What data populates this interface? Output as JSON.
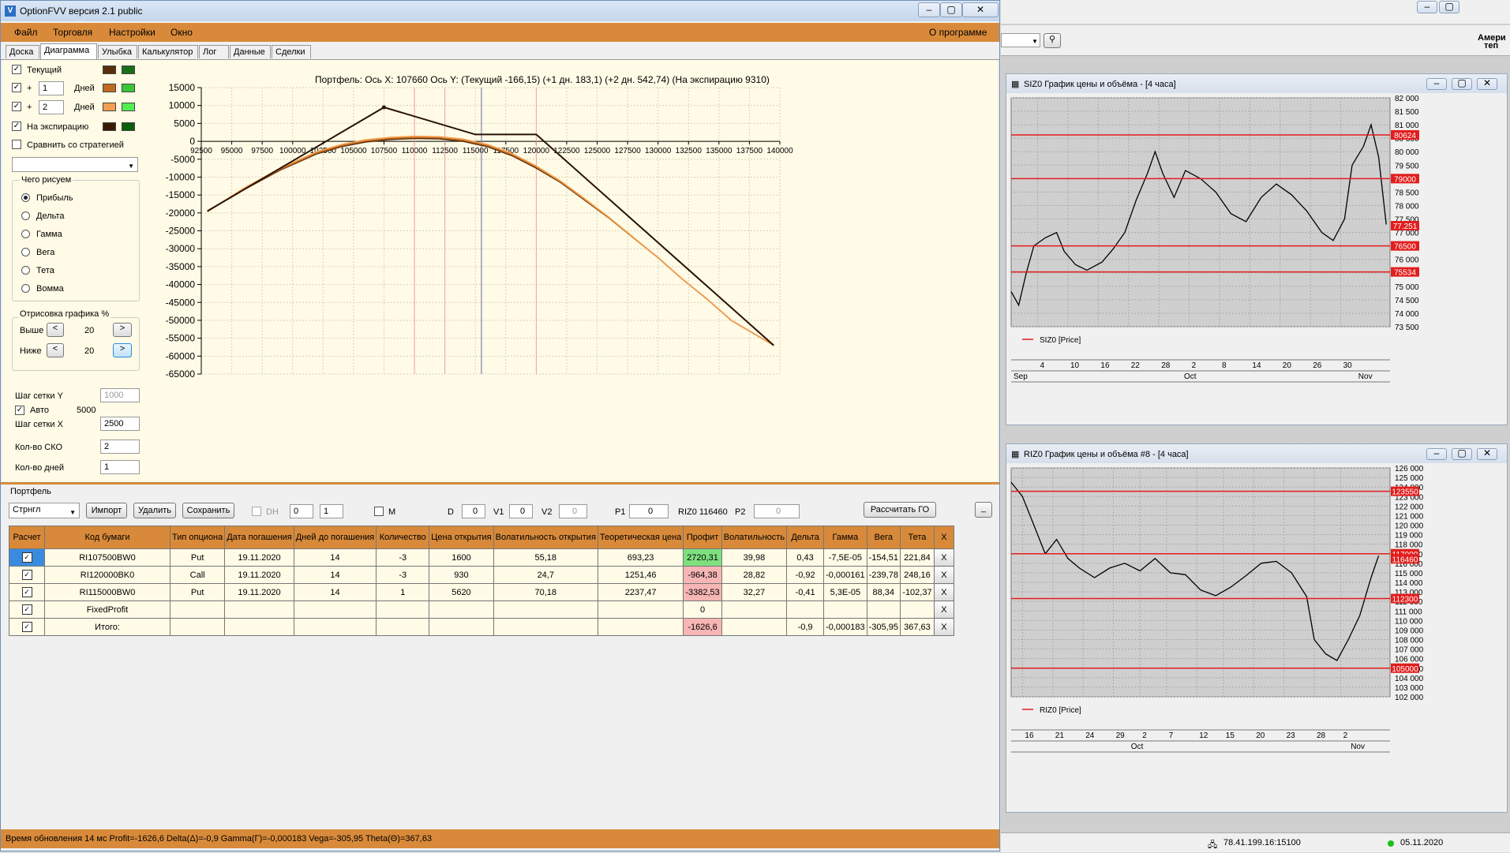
{
  "window": {
    "title": "OptionFVV версия 2.1 public",
    "about": "О программе",
    "menu": [
      "Файл",
      "Торговля",
      "Настройки",
      "Окно"
    ],
    "tabs": [
      "Доска",
      "Диаграмма",
      "Улыбка",
      "Калькулятор",
      "Лог",
      "Данные",
      "Сделки"
    ],
    "active_tab": "Диаграмма"
  },
  "left_panel": {
    "current_label": "Текущий",
    "plus": "+",
    "days_label": "Дней",
    "days1": "1",
    "days2": "2",
    "expiry_label": "На экспирацию",
    "compare_label": "Сравнить со стратегией",
    "what_label": "Чего рисуем",
    "radios": [
      "Прибыль",
      "Дельта",
      "Гамма",
      "Вега",
      "Тета",
      "Вомма"
    ],
    "draw_label": "Отрисовка графика %",
    "above_label": "Выше",
    "below_label": "Ниже",
    "above_value": "20",
    "below_value": "20",
    "step_y_label": "Шаг сетки Y",
    "step_y_value": "1000",
    "auto_label": "Авто",
    "auto_value": "5000",
    "step_x_label": "Шаг сетки X",
    "step_x_value": "2500",
    "sko_label": "Кол-во СКО",
    "sko_value": "2",
    "days_count_label": "Кол-во дней",
    "days_count_value": "1",
    "colors": {
      "current": [
        "#5a2e0a",
        "#1a6e1a"
      ],
      "day1": [
        "#c06a20",
        "#3ac43a"
      ],
      "day2": [
        "#f5a050",
        "#50ee50"
      ],
      "expiry": [
        "#3a1a05",
        "#0b5e0b"
      ]
    }
  },
  "chart_header": "Портфель: Ось X:  107660 Ось Y:   (Текущий -166,15)  (+1 дн. 183,1)  (+2 дн. 542,74)  (На экспирацию 9310)",
  "chart_data": {
    "type": "line",
    "xlim": [
      92500,
      140000
    ],
    "ylim": [
      -65000,
      15000
    ],
    "x_ticks": [
      "92500",
      "95000",
      "97500",
      "100000",
      "102500",
      "105000",
      "107500",
      "110000",
      "112500",
      "115000",
      "117500",
      "120000",
      "122500",
      "125000",
      "127500",
      "130000",
      "132500",
      "135000",
      "137500",
      "140000"
    ],
    "y_ticks": [
      "15000",
      "10000",
      "5000",
      "0",
      "-5000",
      "-10000",
      "-15000",
      "-20000",
      "-25000",
      "-30000",
      "-35000",
      "-40000",
      "-45000",
      "-50000",
      "-55000",
      "-60000",
      "-65000"
    ],
    "cursor_x": 107660,
    "std_lines_x": [
      110000,
      112500,
      120000
    ],
    "current_x": 115500,
    "series": [
      {
        "name": "Текущий",
        "color": "#5a2e0a",
        "points": [
          [
            93000,
            -19500
          ],
          [
            96000,
            -13500
          ],
          [
            99000,
            -8000
          ],
          [
            102000,
            -3500
          ],
          [
            104000,
            -1500
          ],
          [
            106000,
            -200
          ],
          [
            108000,
            500
          ],
          [
            110000,
            800
          ],
          [
            112000,
            700
          ],
          [
            114000,
            0
          ],
          [
            116000,
            -1500
          ],
          [
            118000,
            -4000
          ],
          [
            120000,
            -7500
          ],
          [
            122000,
            -11500
          ],
          [
            124000,
            -16500
          ],
          [
            126000,
            -21500
          ],
          [
            128000,
            -27000
          ],
          [
            130000,
            -32500
          ],
          [
            132000,
            -38500
          ],
          [
            134000,
            -44000
          ],
          [
            136000,
            -50000
          ],
          [
            139500,
            -57000
          ]
        ]
      },
      {
        "name": "+1 дн.",
        "color": "#c06a20",
        "points": [
          [
            93000,
            -19600
          ],
          [
            96000,
            -13300
          ],
          [
            99000,
            -7800
          ],
          [
            102000,
            -3200
          ],
          [
            104000,
            -1200
          ],
          [
            106000,
            100
          ],
          [
            108000,
            800
          ],
          [
            110000,
            1100
          ],
          [
            112000,
            1000
          ],
          [
            114000,
            300
          ],
          [
            116000,
            -1200
          ],
          [
            118000,
            -3700
          ],
          [
            120000,
            -7200
          ],
          [
            122000,
            -11300
          ],
          [
            124000,
            -16300
          ],
          [
            126000,
            -21400
          ],
          [
            128000,
            -27000
          ],
          [
            130000,
            -32500
          ],
          [
            132000,
            -38500
          ],
          [
            134000,
            -44000
          ],
          [
            136000,
            -50000
          ],
          [
            139500,
            -57000
          ]
        ]
      },
      {
        "name": "+2 дн.",
        "color": "#f5a050",
        "points": [
          [
            93000,
            -19700
          ],
          [
            96000,
            -13100
          ],
          [
            99000,
            -7500
          ],
          [
            102000,
            -2900
          ],
          [
            104000,
            -900
          ],
          [
            106000,
            400
          ],
          [
            108000,
            1100
          ],
          [
            110000,
            1400
          ],
          [
            112000,
            1300
          ],
          [
            114000,
            600
          ],
          [
            116000,
            -900
          ],
          [
            118000,
            -3400
          ],
          [
            120000,
            -6900
          ],
          [
            122000,
            -11100
          ],
          [
            124000,
            -16100
          ],
          [
            126000,
            -21300
          ],
          [
            128000,
            -26900
          ],
          [
            130000,
            -32500
          ],
          [
            132000,
            -38500
          ],
          [
            134000,
            -44000
          ],
          [
            136000,
            -50000
          ],
          [
            139500,
            -57000
          ]
        ]
      },
      {
        "name": "На экспирацию",
        "color": "#2a1205",
        "points": [
          [
            93000,
            -19500
          ],
          [
            107500,
            9500
          ],
          [
            115000,
            1900
          ],
          [
            120000,
            1900
          ],
          [
            139500,
            -57000
          ]
        ]
      }
    ]
  },
  "portfolio": {
    "label": "Портфель",
    "combo": "Стрнгл",
    "import": "Импорт",
    "delete": "Удалить",
    "save": "Сохранить",
    "dh": "DH",
    "dh_val1": "0",
    "dh_val2": "1",
    "m": "M",
    "d_label": "D",
    "d_val": "0",
    "v1_label": "V1",
    "v1_val": "0",
    "v2_label": "V2",
    "v2_val": "0",
    "p1_label": "P1",
    "p1_val": "0",
    "riz_label": "RIZ0 116460",
    "p2_label": "P2",
    "p2_val": "0",
    "calc_go": "Рассчитать ГО",
    "minimize": "_",
    "headers": [
      "Расчет",
      "Код бумаги",
      "Тип опциона",
      "Дата погашения",
      "Дней до погашения",
      "Количество",
      "Цена открытия",
      "Волатильность открытия",
      "Теоретическая цена",
      "Профит",
      "Волатильность",
      "Дельта",
      "Гамма",
      "Вега",
      "Тета",
      "X"
    ],
    "rows": [
      [
        "RI107500BW0",
        "Put",
        "19.11.2020",
        "14",
        "-3",
        "1600",
        "55,18",
        "693,23",
        "2720,31",
        "39,98",
        "0,43",
        "-7,5E-05",
        "-154,51",
        "221,84",
        "X"
      ],
      [
        "RI120000BK0",
        "Call",
        "19.11.2020",
        "14",
        "-3",
        "930",
        "24,7",
        "1251,46",
        "-964,38",
        "28,82",
        "-0,92",
        "-0,000161",
        "-239,78",
        "248,16",
        "X"
      ],
      [
        "RI115000BW0",
        "Put",
        "19.11.2020",
        "14",
        "1",
        "5620",
        "70,18",
        "2237,47",
        "-3382,53",
        "32,27",
        "-0,41",
        "5,3E-05",
        "88,34",
        "-102,37",
        "X"
      ],
      [
        "FixedProfit",
        "",
        "",
        "",
        "",
        "",
        "",
        "",
        "0",
        "",
        "",
        "",
        "",
        "",
        "X"
      ],
      [
        "Итого:",
        "",
        "",
        "",
        "",
        "",
        "",
        "",
        "-1626,6",
        "",
        "-0,9",
        "-0,000183",
        "-305,95",
        "367,63",
        "X"
      ]
    ]
  },
  "status": "Время обновления 14 мс  Profit=-1626,6 Delta(Δ)=-0,9 Gamma(Γ)=-0,000183 Vega=-305,95 Theta(Θ)=367,63",
  "right": {
    "top_label": "Амери",
    "top_label2": "теп",
    "chart1": {
      "title": "SIZ0 График цены и объёма - [4 часа]",
      "legend": "SIZ0 [Price]",
      "y_labels": [
        "82 000",
        "81 500",
        "81 000",
        "80 500",
        "80 000",
        "79 500",
        "79 000",
        "78 500",
        "78 000",
        "77 500",
        "77 000",
        "76 500",
        "76 000",
        "75 500",
        "75 000",
        "74 500",
        "74 000",
        "73 500"
      ],
      "x_labels": [
        "4",
        "10",
        "16",
        "22",
        "28",
        "2",
        "8",
        "14",
        "20",
        "26",
        "30"
      ],
      "months": [
        "Sep",
        "Oct",
        "Nov"
      ],
      "tags": [
        "80624",
        "79000",
        "77.251",
        "76500",
        "75534"
      ]
    },
    "chart2": {
      "title": "RIZ0 График цены и объёма #8 - [4 часа]",
      "legend": "RIZ0 [Price]",
      "y_labels": [
        "126 000",
        "125 000",
        "124 000",
        "123 000",
        "122 000",
        "121 000",
        "120 000",
        "119 000",
        "118 000",
        "117 000",
        "116 000",
        "115 000",
        "114 000",
        "113 000",
        "112 000",
        "111 000",
        "110 000",
        "109 000",
        "108 000",
        "107 000",
        "106 000",
        "105 000",
        "104 000",
        "103 000",
        "102 000"
      ],
      "x_labels": [
        "16",
        "21",
        "24",
        "29",
        "2",
        "7",
        "12",
        "15",
        "20",
        "23",
        "28",
        "2"
      ],
      "months": [
        "Oct",
        "Nov"
      ],
      "tags": [
        "123550",
        "117000",
        "116460",
        "112300",
        "105000"
      ]
    },
    "status_ip": "78.41.199.16:15100",
    "status_date": "05.11.2020"
  }
}
